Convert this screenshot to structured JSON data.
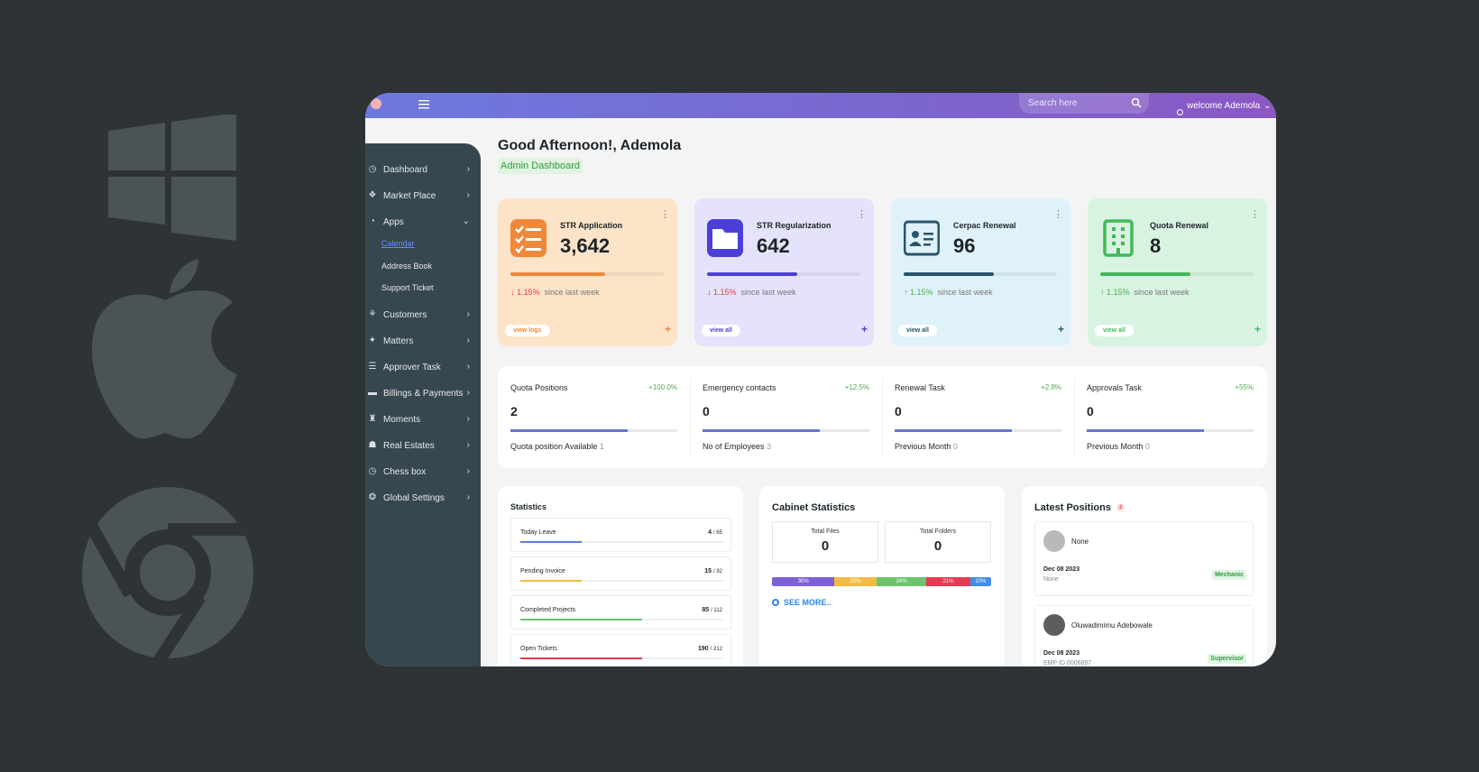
{
  "topbar": {
    "search_placeholder": "Search here",
    "welcome": "welcome Ademola"
  },
  "sidebar": {
    "items": [
      {
        "label": "Dashboard",
        "icon": "dashboard-icon"
      },
      {
        "label": "Market Place",
        "icon": "marketplace-icon"
      },
      {
        "label": "Apps",
        "icon": "apps-icon"
      },
      {
        "label": "Customers",
        "icon": "customers-icon"
      },
      {
        "label": "Matters",
        "icon": "matters-icon"
      },
      {
        "label": "Approver Task",
        "icon": "approver-task-icon"
      },
      {
        "label": "Billings & Payments",
        "icon": "billing-icon"
      },
      {
        "label": "Moments",
        "icon": "moments-icon"
      },
      {
        "label": "Real Estates",
        "icon": "real-estates-icon"
      },
      {
        "label": "Chess box",
        "icon": "chess-box-icon"
      },
      {
        "label": "Global Settings",
        "icon": "settings-icon"
      }
    ],
    "apps_sub": [
      "Calendar",
      "Address Book",
      "Support Ticket"
    ]
  },
  "header": {
    "greeting": "Good Afternoon!, Ademola",
    "badge": "Admin Dashboard"
  },
  "cards": [
    {
      "title": "STR Application",
      "value": "3,642",
      "progress": 0.62,
      "trend": "1.15%",
      "trend_dir": "down",
      "since": "since last week",
      "button": "view logs",
      "bg": "#fde3c7",
      "accent": "#f0883a"
    },
    {
      "title": "STR Regularization",
      "value": "642",
      "progress": 0.59,
      "trend": "1.15%",
      "trend_dir": "down",
      "since": "since last week",
      "button": "view all",
      "bg": "#e4e3fb",
      "accent": "#4b3fd8"
    },
    {
      "title": "Cerpac Renewal",
      "value": "96",
      "progress": 0.59,
      "trend": "1.15%",
      "trend_dir": "up",
      "since": "since last week",
      "button": "view all",
      "bg": "#dff2f9",
      "accent": "#27566a"
    },
    {
      "title": "Quota Renewal",
      "value": "8",
      "progress": 0.59,
      "trend": "1.15%",
      "trend_dir": "up",
      "since": "since last week",
      "button": "view all",
      "bg": "#d8f3e2",
      "accent": "#41b95a"
    }
  ],
  "metrics": [
    {
      "title": "Quota Positions",
      "pct": "+100.0%",
      "value": "2",
      "sub_label": "Quota position Available",
      "sub_value": "1",
      "progress": 0.7
    },
    {
      "title": "Emergency contacts",
      "pct": "+12.5%",
      "value": "0",
      "sub_label": "No of Employees",
      "sub_value": "3",
      "progress": 0.7
    },
    {
      "title": "Renewal Task",
      "pct": "+2.8%",
      "value": "0",
      "sub_label": "Previous Month",
      "sub_value": "0",
      "progress": 0.7
    },
    {
      "title": "Approvals Task",
      "pct": "+55%",
      "value": "0",
      "sub_label": "Previous Month",
      "sub_value": "0",
      "progress": 0.7
    }
  ],
  "statistics": {
    "title": "Statistics",
    "rows": [
      {
        "label": "Today Leave",
        "value": "4",
        "total": "65",
        "progress": 0.3,
        "color": "#5b7cf0"
      },
      {
        "label": "Pending Invoice",
        "value": "15",
        "total": "92",
        "progress": 0.3,
        "color": "#f4bb3c"
      },
      {
        "label": "Completed Projects",
        "value": "85",
        "total": "112",
        "progress": 0.6,
        "color": "#69c26b"
      },
      {
        "label": "Open Tickets",
        "value": "190",
        "total": "212",
        "progress": 0.6,
        "color": "#ea3b52"
      }
    ]
  },
  "cabinet": {
    "title": "Cabinet Statistics",
    "total_files_label": "Total Files",
    "total_files": "0",
    "total_folders_label": "Total Folders",
    "total_folders": "0",
    "segments": [
      {
        "label": "30%",
        "value": 30,
        "color": "#7d5fd6"
      },
      {
        "label": "20%",
        "value": 20,
        "color": "#f3bb45"
      },
      {
        "label": "24%",
        "value": 24,
        "color": "#6cc46c"
      },
      {
        "label": "21%",
        "value": 21,
        "color": "#e53c53"
      },
      {
        "label": "10%",
        "value": 10,
        "color": "#3f8fe6"
      }
    ],
    "see_more": "SEE MORE.."
  },
  "latest": {
    "title": "Latest Positions",
    "count": "2",
    "positions": [
      {
        "name": "None",
        "date": "Dec 08 2023",
        "extra": "None",
        "role": "Mechanic"
      },
      {
        "name": "Oluwadimimu Adebowale",
        "date": "Dec 08 2023",
        "extra": "EMP ID 0006897",
        "role": "Supervisor"
      }
    ]
  }
}
